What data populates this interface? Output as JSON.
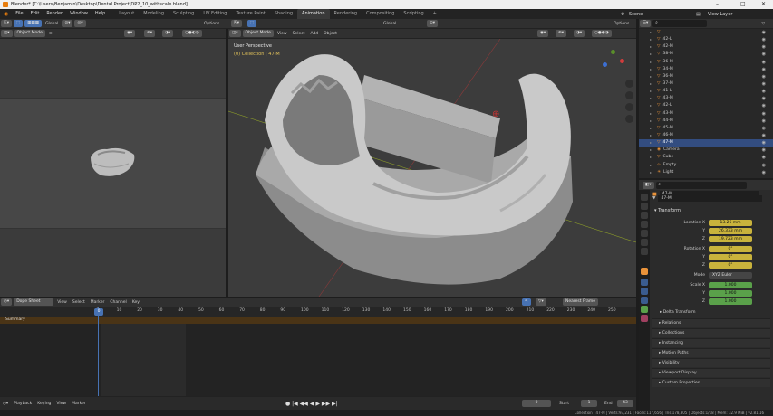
{
  "window": {
    "title": "Blender* [C:\\Users\\Benjamin\\Desktop\\Dental Project\\DP2_10_withscale.blend]"
  },
  "menu": [
    "File",
    "Edit",
    "Render",
    "Window",
    "Help"
  ],
  "workspaces": [
    "Layout",
    "Modeling",
    "Sculpting",
    "UV Editing",
    "Texture Paint",
    "Shading",
    "Animation",
    "Rendering",
    "Compositing",
    "Scripting"
  ],
  "active_workspace": "Animation",
  "top_right": {
    "scene_label": "Scene",
    "view_layer_label": "View Layer"
  },
  "left_view": {
    "mode": "Object Mode",
    "orientation": "Global",
    "options": "Options"
  },
  "main_view": {
    "mode": "Object Mode",
    "menus": [
      "View",
      "Select",
      "Add",
      "Object"
    ],
    "orientation": "Global",
    "options": "Options",
    "perspective": "User Perspective",
    "collection_info": "(0) Collection | 47-M"
  },
  "dope_sheet": {
    "editor": "Dope Sheet",
    "menus": [
      "View",
      "Select",
      "Marker",
      "Channel",
      "Key"
    ],
    "interpolation": "Nearest Frame",
    "ticks": [
      "0",
      "10",
      "20",
      "30",
      "40",
      "50",
      "60",
      "70",
      "80",
      "90",
      "100",
      "110",
      "120",
      "130",
      "140",
      "150",
      "160",
      "170",
      "180",
      "190",
      "200",
      "210",
      "220",
      "230",
      "240",
      "250"
    ],
    "current_frame": "0",
    "summary": "Summary"
  },
  "playback": {
    "menus": [
      "Playback",
      "Keying",
      "View",
      "Marker"
    ],
    "frame": "0",
    "start_label": "Start",
    "start": "1",
    "end_label": "End",
    "end": "43"
  },
  "outliner": {
    "rows": [
      {
        "label": "",
        "icon": "mesh"
      },
      {
        "label": "42-L",
        "icon": "mesh"
      },
      {
        "label": "42-M",
        "icon": "mesh"
      },
      {
        "label": "38-M",
        "icon": "mesh"
      },
      {
        "label": "36-M",
        "icon": "mesh"
      },
      {
        "label": "34-M",
        "icon": "mesh"
      },
      {
        "label": "36-M",
        "icon": "mesh"
      },
      {
        "label": "37-M",
        "icon": "mesh"
      },
      {
        "label": "41-L",
        "icon": "mesh"
      },
      {
        "label": "43-M",
        "icon": "mesh"
      },
      {
        "label": "42-L",
        "icon": "mesh"
      },
      {
        "label": "43-M",
        "icon": "mesh"
      },
      {
        "label": "44-M",
        "icon": "mesh"
      },
      {
        "label": "45-M",
        "icon": "mesh"
      },
      {
        "label": "46-M",
        "icon": "mesh"
      },
      {
        "label": "47-M",
        "icon": "mesh",
        "selected": true
      },
      {
        "label": "Camera",
        "icon": "camera"
      },
      {
        "label": "Cube",
        "icon": "mesh"
      },
      {
        "label": "Empty",
        "icon": "empty"
      },
      {
        "label": "Light",
        "icon": "light"
      }
    ]
  },
  "properties": {
    "object_name": "47-M",
    "mesh_name": "47-M",
    "transform_label": "Transform",
    "location_label": "Location X",
    "location": [
      "13.26 mm",
      "26.333 mm",
      "19.723 mm"
    ],
    "rotation_label": "Rotation X",
    "rotation": [
      "0°",
      "0°",
      "0°"
    ],
    "mode_label": "Mode",
    "mode_value": "XYZ Euler",
    "scale_label": "Scale X",
    "scale": [
      "1.000",
      "1.000",
      "1.000"
    ],
    "y_label": "Y",
    "z_label": "Z",
    "delta_label": "Delta Transform",
    "panels": [
      "Relations",
      "Collections",
      "Instancing",
      "Motion Paths",
      "Visibility",
      "Viewport Display",
      "Custom Properties"
    ]
  },
  "status": {
    "text": "Collection | 47-M | Verts:93,231 | Faces:117,656 | Tris:178,305 | Objects:1/18 | Mem: 32.9 MiB | v2.81.16"
  },
  "colors": {
    "accent": "#4772b3",
    "selected": "#334d80",
    "location": "#c9b33c",
    "scale": "#5aa14a"
  }
}
